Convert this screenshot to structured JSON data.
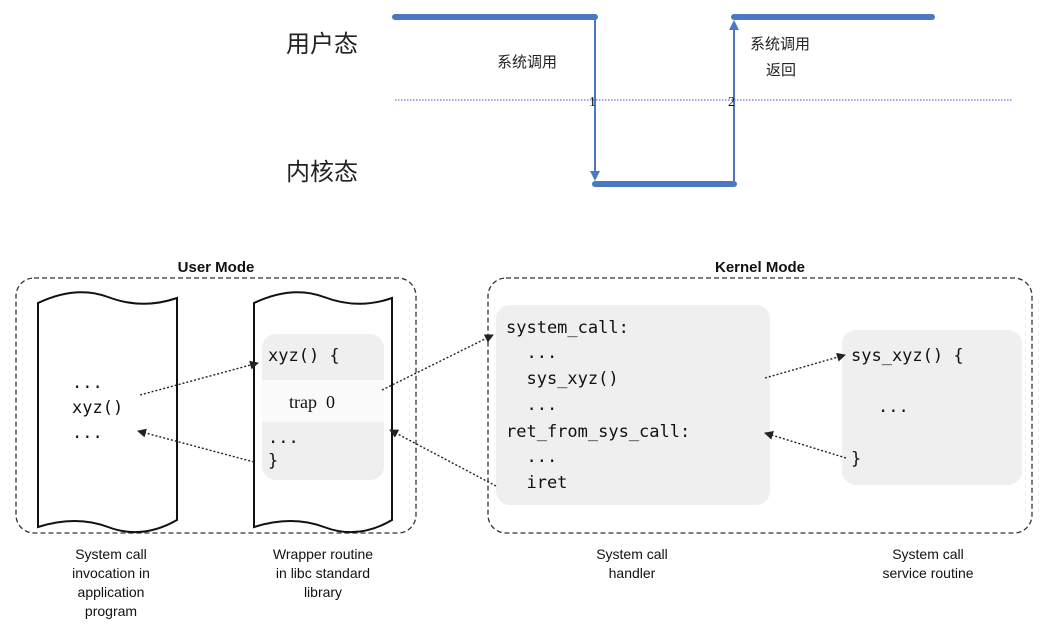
{
  "top": {
    "user_state": "用户态",
    "kernel_state": "内核态",
    "syscall": "系统调用",
    "syscall_return_line1": "系统调用",
    "syscall_return_line2": "返回",
    "marker1": "1",
    "marker2": "2"
  },
  "bottom": {
    "user_mode_title": "User Mode",
    "kernel_mode_title": "Kernel Mode",
    "app_code": [
      "...",
      "xyz()",
      "..."
    ],
    "wrapper_code": {
      "head": "xyz() {",
      "trap": "trap  0",
      "dots": "...",
      "close": "}"
    },
    "handler_code": [
      "system_call:",
      "  ...",
      "  sys_xyz()",
      "  ...",
      "ret_from_sys_call:",
      "  ...",
      "  iret"
    ],
    "service_code": {
      "head": "sys_xyz() {",
      "dots": "...",
      "close": "}"
    },
    "captions": {
      "app": [
        "System call",
        "invocation in",
        "application",
        "program"
      ],
      "wrapper": [
        "Wrapper routine",
        "in libc standard",
        "library"
      ],
      "handler": [
        "System call",
        "handler"
      ],
      "service": [
        "System call",
        "service routine"
      ]
    }
  },
  "colors": {
    "accent_blue": "#4a78c2",
    "dotted_blue": "#3b4fd0",
    "panel_gray": "#efefef"
  }
}
